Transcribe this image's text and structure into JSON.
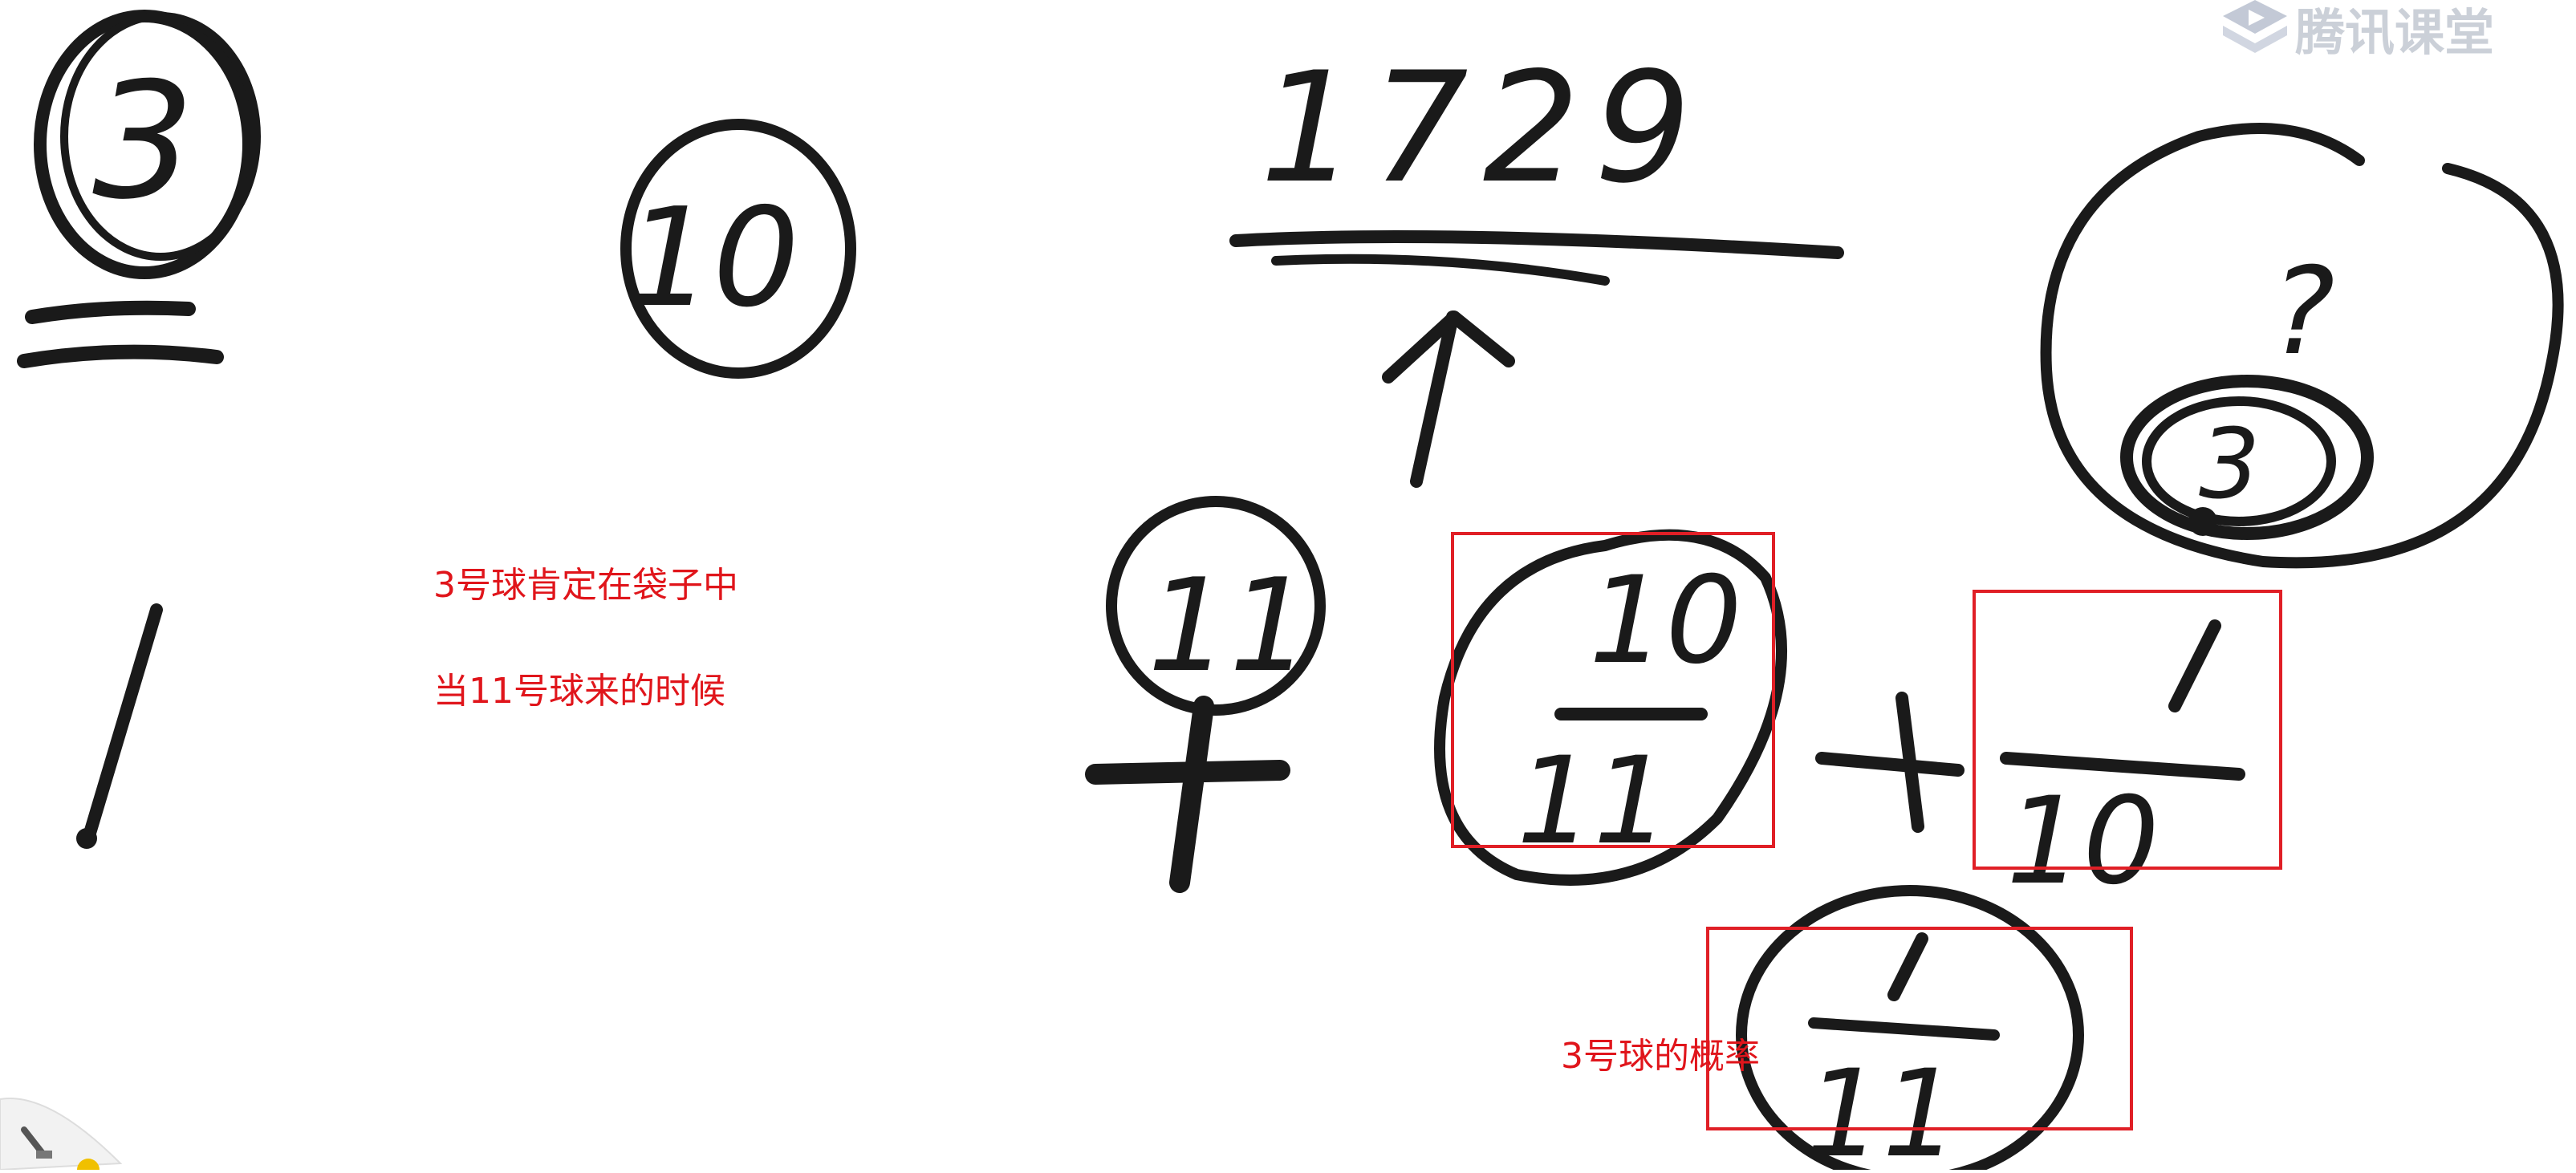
{
  "watermark": {
    "brand": "腾讯课堂",
    "icon": "play-logo-icon"
  },
  "board": {
    "numbers": {
      "ball_3": "3",
      "ball_10": "10",
      "big_number": "1729",
      "question": "?",
      "inner_3": "3",
      "ball_11": "11",
      "frac_a_num": "10",
      "frac_a_den": "11",
      "times": "×",
      "frac_b_num": "1",
      "frac_b_den": "10",
      "frac_c_num": "1",
      "frac_c_den": "11",
      "left_one": "1"
    }
  },
  "annotations": {
    "line1": "3号球肯定在袋子中",
    "line2": "当11号球来的时候",
    "line3": "3号球的概率"
  },
  "colors": {
    "ink": "#1a1a1a",
    "annotation": "#e0151b",
    "box": "#e01f26"
  },
  "toolbar": {
    "tool_icon": "brush-icon"
  }
}
